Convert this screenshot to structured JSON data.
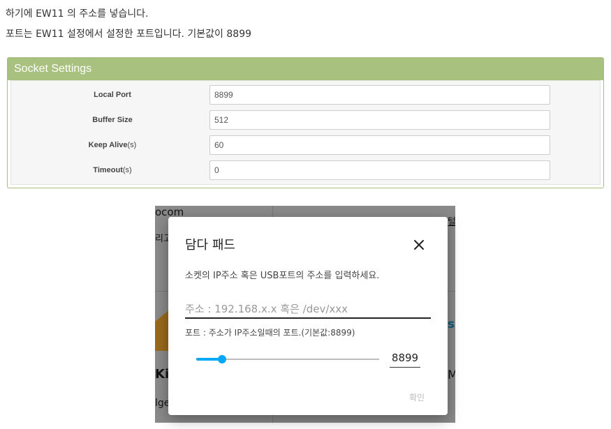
{
  "intro": {
    "line1": "하기에 EW11 의 주소를 넣습니다.",
    "line2": "포트는 EW11 설정에서 설정한 포트입니다. 기본값이 8899"
  },
  "socket_panel": {
    "title": "Socket Settings",
    "rows": [
      {
        "label": "Local Port",
        "unit": "",
        "value": "8899"
      },
      {
        "label": "Buffer Size",
        "unit": "",
        "value": "512"
      },
      {
        "label": "Keep Alive",
        "unit": "(s)",
        "value": "60"
      },
      {
        "label": "Timeout",
        "unit": "(s)",
        "value": "0"
      }
    ],
    "header_color": "#a9c17e"
  },
  "background": {
    "fragments": [
      "ocom",
      "리고",
      "Kit",
      "lge",
      "s",
      "M",
      "털"
    ]
  },
  "dialog": {
    "title": "담다 패드",
    "close_icon": "close-icon",
    "description": "소켓의 IP주소 혹은 USB포트의 주소를 입력하세요.",
    "address_placeholder": "주소 : 192.168.x.x 혹은 /dev/xxx",
    "address_value": "",
    "port_help": "포트 : 주소가 IP주소일때의 포트.(기본값:8899)",
    "port_value": "8899",
    "slider_fraction": 0.14,
    "accent_color": "#03a9f4",
    "confirm_label": "확인"
  }
}
